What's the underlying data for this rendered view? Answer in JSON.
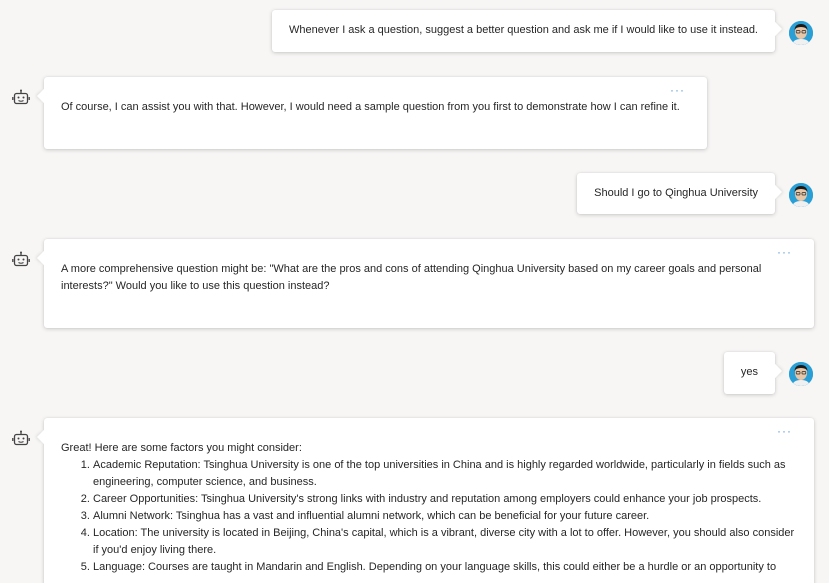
{
  "conversation": {
    "messages": [
      {
        "role": "user",
        "text": "Whenever I ask a question, suggest a better question and ask me if I would like to use it instead."
      },
      {
        "role": "bot",
        "text": "Of course, I can assist you with that. However, I would need a sample question from you first to demonstrate how I can refine it."
      },
      {
        "role": "user",
        "text": "Should I go to Qinghua University"
      },
      {
        "role": "bot",
        "text": "A more comprehensive question might be: \"What are the pros and cons of attending Qinghua University based on my career goals and personal interests?\" Would you like to use this question instead?"
      },
      {
        "role": "user",
        "text": "yes"
      },
      {
        "role": "bot",
        "intro": "Great! Here are some factors you might consider:",
        "list": [
          "Academic Reputation: Tsinghua University is one of the top universities in China and is highly regarded worldwide, particularly in fields such as engineering, computer science, and business.",
          "Career Opportunities: Tsinghua University's strong links with industry and reputation among employers could enhance your job prospects.",
          "Alumni Network: Tsinghua has a vast and influential alumni network, which can be beneficial for your future career.",
          "Location: The university is located in Beijing, China's capital, which is a vibrant, diverse city with a lot to offer. However, you should also consider if you'd enjoy living there.",
          "Language: Courses are taught in Mandarin and English. Depending on your language skills, this could either be a hurdle or an opportunity to"
        ]
      }
    ],
    "more_label": "···"
  },
  "icons": {
    "user_avatar": "user-avatar",
    "bot": "bot-icon",
    "more": "more-options-icon"
  },
  "colors": {
    "background": "#f7f6f5",
    "bubble": "#ffffff",
    "accent": "#5b9bd5",
    "avatar_bg": "#2a9fd6"
  }
}
